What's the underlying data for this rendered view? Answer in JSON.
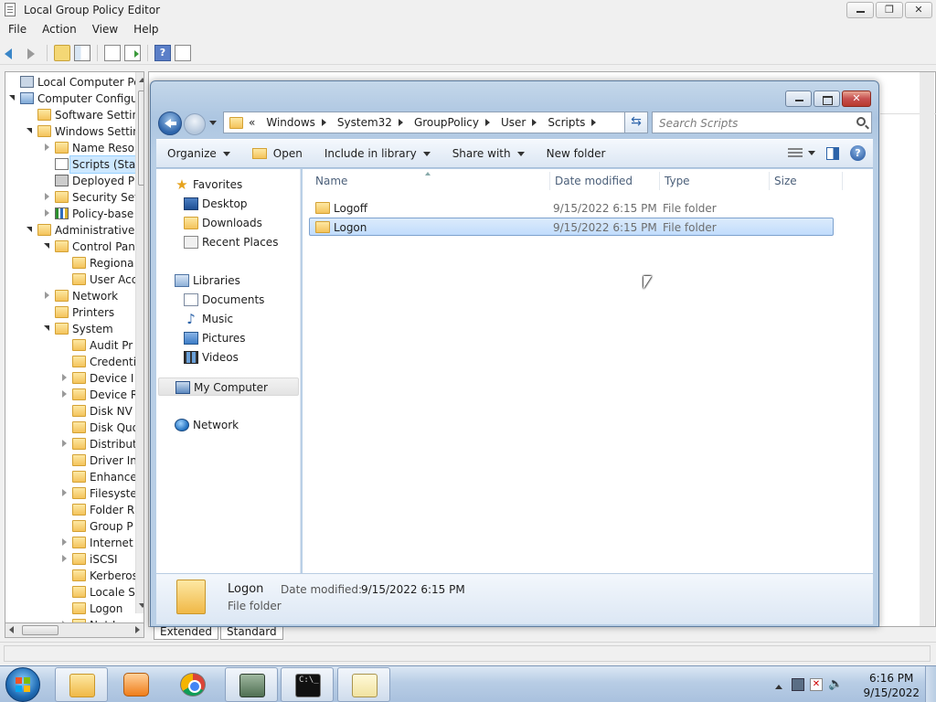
{
  "gpe": {
    "title": "Local Group Policy Editor",
    "menu": [
      "File",
      "Action",
      "View",
      "Help"
    ],
    "view_tabs": [
      "Extended",
      "Standard"
    ],
    "tree": [
      {
        "label": "Local Computer Policy",
        "depth": 0,
        "expander": "none",
        "icon": "policy-icon"
      },
      {
        "label": "Computer Configu",
        "depth": 0,
        "expander": "open",
        "icon": "computer-icon"
      },
      {
        "label": "Software Setting",
        "depth": 1,
        "expander": "none",
        "icon": "folder-icon"
      },
      {
        "label": "Windows Settin",
        "depth": 1,
        "expander": "open",
        "icon": "folder-icon"
      },
      {
        "label": "Name Resol",
        "depth": 2,
        "expander": "closed",
        "icon": "folder-icon"
      },
      {
        "label": "Scripts (Star",
        "depth": 2,
        "expander": "none",
        "icon": "script-icon",
        "selected": true
      },
      {
        "label": "Deployed Pr",
        "depth": 2,
        "expander": "none",
        "icon": "printer-icon"
      },
      {
        "label": "Security Set",
        "depth": 2,
        "expander": "closed",
        "icon": "folder-icon"
      },
      {
        "label": "Policy-base",
        "depth": 2,
        "expander": "closed",
        "icon": "bars-icon"
      },
      {
        "label": "Administrative T",
        "depth": 1,
        "expander": "open",
        "icon": "folder-icon"
      },
      {
        "label": "Control Pan",
        "depth": 2,
        "expander": "open",
        "icon": "folder-icon"
      },
      {
        "label": "Regiona",
        "depth": 3,
        "expander": "none",
        "icon": "folder-icon"
      },
      {
        "label": "User Acc",
        "depth": 3,
        "expander": "none",
        "icon": "folder-icon"
      },
      {
        "label": "Network",
        "depth": 2,
        "expander": "closed",
        "icon": "folder-icon"
      },
      {
        "label": "Printers",
        "depth": 2,
        "expander": "none",
        "icon": "folder-icon"
      },
      {
        "label": "System",
        "depth": 2,
        "expander": "open",
        "icon": "folder-icon"
      },
      {
        "label": "Audit Pr",
        "depth": 3,
        "expander": "none",
        "icon": "folder-icon"
      },
      {
        "label": "Credenti",
        "depth": 3,
        "expander": "none",
        "icon": "folder-icon"
      },
      {
        "label": "Device I",
        "depth": 3,
        "expander": "closed",
        "icon": "folder-icon"
      },
      {
        "label": "Device R",
        "depth": 3,
        "expander": "closed",
        "icon": "folder-icon"
      },
      {
        "label": "Disk NV",
        "depth": 3,
        "expander": "none",
        "icon": "folder-icon"
      },
      {
        "label": "Disk Quo",
        "depth": 3,
        "expander": "none",
        "icon": "folder-icon"
      },
      {
        "label": "Distribut",
        "depth": 3,
        "expander": "closed",
        "icon": "folder-icon"
      },
      {
        "label": "Driver In",
        "depth": 3,
        "expander": "none",
        "icon": "folder-icon"
      },
      {
        "label": "Enhance",
        "depth": 3,
        "expander": "none",
        "icon": "folder-icon"
      },
      {
        "label": "Filesyste",
        "depth": 3,
        "expander": "closed",
        "icon": "folder-icon"
      },
      {
        "label": "Folder R",
        "depth": 3,
        "expander": "none",
        "icon": "folder-icon"
      },
      {
        "label": "Group P",
        "depth": 3,
        "expander": "none",
        "icon": "folder-icon"
      },
      {
        "label": "Internet",
        "depth": 3,
        "expander": "closed",
        "icon": "folder-icon"
      },
      {
        "label": "iSCSI",
        "depth": 3,
        "expander": "closed",
        "icon": "folder-icon"
      },
      {
        "label": "Kerberos",
        "depth": 3,
        "expander": "none",
        "icon": "folder-icon"
      },
      {
        "label": "Locale S",
        "depth": 3,
        "expander": "none",
        "icon": "folder-icon"
      },
      {
        "label": "Logon",
        "depth": 3,
        "expander": "none",
        "icon": "folder-icon"
      },
      {
        "label": "Net Log",
        "depth": 3,
        "expander": "closed",
        "icon": "folder-icon"
      }
    ]
  },
  "explorer": {
    "breadcrumb": [
      "«",
      "Windows",
      "System32",
      "GroupPolicy",
      "User",
      "Scripts"
    ],
    "search_placeholder": "Search Scripts",
    "commands": {
      "organize": "Organize",
      "open": "Open",
      "include": "Include in library",
      "share": "Share with",
      "new_folder": "New folder"
    },
    "nav": {
      "favorites": "Favorites",
      "desktop": "Desktop",
      "downloads": "Downloads",
      "recent": "Recent Places",
      "libraries": "Libraries",
      "documents": "Documents",
      "music": "Music",
      "pictures": "Pictures",
      "videos": "Videos",
      "mycomputer": "My Computer",
      "network": "Network"
    },
    "columns": {
      "name": "Name",
      "date": "Date modified",
      "type": "Type",
      "size": "Size"
    },
    "files": [
      {
        "name": "Logoff",
        "date": "9/15/2022 6:15 PM",
        "type": "File folder",
        "selected": false
      },
      {
        "name": "Logon",
        "date": "9/15/2022 6:15 PM",
        "type": "File folder",
        "selected": true
      }
    ],
    "details": {
      "name": "Logon",
      "date_label": "Date modified:",
      "date_value": "9/15/2022 6:15 PM",
      "type": "File folder"
    }
  },
  "taskbar": {
    "time": "6:16 PM",
    "date": "9/15/2022",
    "apps": [
      "explorer",
      "media-player",
      "chrome",
      "group-policy-editor",
      "command-prompt",
      "notepad"
    ],
    "cmd_glyph": "C:\\_"
  }
}
